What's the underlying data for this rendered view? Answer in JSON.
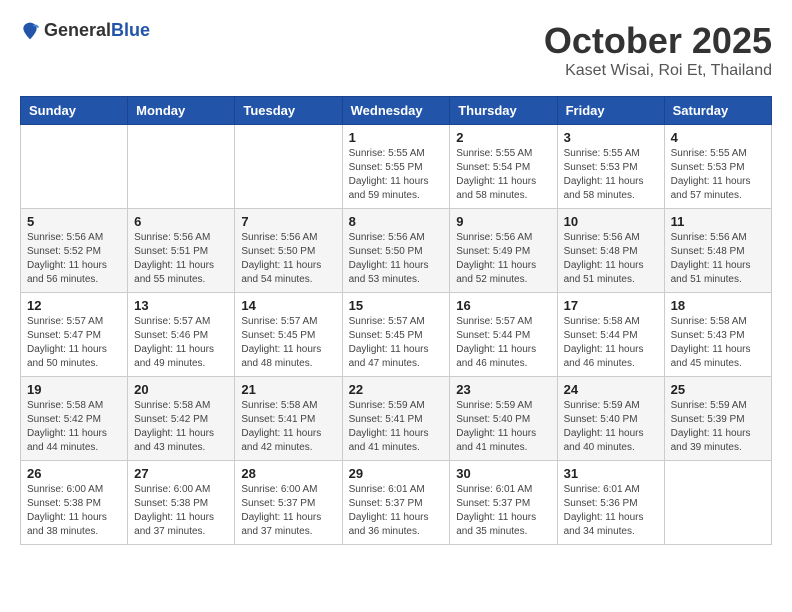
{
  "header": {
    "logo_general": "General",
    "logo_blue": "Blue",
    "month": "October 2025",
    "location": "Kaset Wisai, Roi Et, Thailand"
  },
  "days_of_week": [
    "Sunday",
    "Monday",
    "Tuesday",
    "Wednesday",
    "Thursday",
    "Friday",
    "Saturday"
  ],
  "weeks": [
    [
      {
        "day": "",
        "info": ""
      },
      {
        "day": "",
        "info": ""
      },
      {
        "day": "",
        "info": ""
      },
      {
        "day": "1",
        "info": "Sunrise: 5:55 AM\nSunset: 5:55 PM\nDaylight: 11 hours\nand 59 minutes."
      },
      {
        "day": "2",
        "info": "Sunrise: 5:55 AM\nSunset: 5:54 PM\nDaylight: 11 hours\nand 58 minutes."
      },
      {
        "day": "3",
        "info": "Sunrise: 5:55 AM\nSunset: 5:53 PM\nDaylight: 11 hours\nand 58 minutes."
      },
      {
        "day": "4",
        "info": "Sunrise: 5:55 AM\nSunset: 5:53 PM\nDaylight: 11 hours\nand 57 minutes."
      }
    ],
    [
      {
        "day": "5",
        "info": "Sunrise: 5:56 AM\nSunset: 5:52 PM\nDaylight: 11 hours\nand 56 minutes."
      },
      {
        "day": "6",
        "info": "Sunrise: 5:56 AM\nSunset: 5:51 PM\nDaylight: 11 hours\nand 55 minutes."
      },
      {
        "day": "7",
        "info": "Sunrise: 5:56 AM\nSunset: 5:50 PM\nDaylight: 11 hours\nand 54 minutes."
      },
      {
        "day": "8",
        "info": "Sunrise: 5:56 AM\nSunset: 5:50 PM\nDaylight: 11 hours\nand 53 minutes."
      },
      {
        "day": "9",
        "info": "Sunrise: 5:56 AM\nSunset: 5:49 PM\nDaylight: 11 hours\nand 52 minutes."
      },
      {
        "day": "10",
        "info": "Sunrise: 5:56 AM\nSunset: 5:48 PM\nDaylight: 11 hours\nand 51 minutes."
      },
      {
        "day": "11",
        "info": "Sunrise: 5:56 AM\nSunset: 5:48 PM\nDaylight: 11 hours\nand 51 minutes."
      }
    ],
    [
      {
        "day": "12",
        "info": "Sunrise: 5:57 AM\nSunset: 5:47 PM\nDaylight: 11 hours\nand 50 minutes."
      },
      {
        "day": "13",
        "info": "Sunrise: 5:57 AM\nSunset: 5:46 PM\nDaylight: 11 hours\nand 49 minutes."
      },
      {
        "day": "14",
        "info": "Sunrise: 5:57 AM\nSunset: 5:45 PM\nDaylight: 11 hours\nand 48 minutes."
      },
      {
        "day": "15",
        "info": "Sunrise: 5:57 AM\nSunset: 5:45 PM\nDaylight: 11 hours\nand 47 minutes."
      },
      {
        "day": "16",
        "info": "Sunrise: 5:57 AM\nSunset: 5:44 PM\nDaylight: 11 hours\nand 46 minutes."
      },
      {
        "day": "17",
        "info": "Sunrise: 5:58 AM\nSunset: 5:44 PM\nDaylight: 11 hours\nand 46 minutes."
      },
      {
        "day": "18",
        "info": "Sunrise: 5:58 AM\nSunset: 5:43 PM\nDaylight: 11 hours\nand 45 minutes."
      }
    ],
    [
      {
        "day": "19",
        "info": "Sunrise: 5:58 AM\nSunset: 5:42 PM\nDaylight: 11 hours\nand 44 minutes."
      },
      {
        "day": "20",
        "info": "Sunrise: 5:58 AM\nSunset: 5:42 PM\nDaylight: 11 hours\nand 43 minutes."
      },
      {
        "day": "21",
        "info": "Sunrise: 5:58 AM\nSunset: 5:41 PM\nDaylight: 11 hours\nand 42 minutes."
      },
      {
        "day": "22",
        "info": "Sunrise: 5:59 AM\nSunset: 5:41 PM\nDaylight: 11 hours\nand 41 minutes."
      },
      {
        "day": "23",
        "info": "Sunrise: 5:59 AM\nSunset: 5:40 PM\nDaylight: 11 hours\nand 41 minutes."
      },
      {
        "day": "24",
        "info": "Sunrise: 5:59 AM\nSunset: 5:40 PM\nDaylight: 11 hours\nand 40 minutes."
      },
      {
        "day": "25",
        "info": "Sunrise: 5:59 AM\nSunset: 5:39 PM\nDaylight: 11 hours\nand 39 minutes."
      }
    ],
    [
      {
        "day": "26",
        "info": "Sunrise: 6:00 AM\nSunset: 5:38 PM\nDaylight: 11 hours\nand 38 minutes."
      },
      {
        "day": "27",
        "info": "Sunrise: 6:00 AM\nSunset: 5:38 PM\nDaylight: 11 hours\nand 37 minutes."
      },
      {
        "day": "28",
        "info": "Sunrise: 6:00 AM\nSunset: 5:37 PM\nDaylight: 11 hours\nand 37 minutes."
      },
      {
        "day": "29",
        "info": "Sunrise: 6:01 AM\nSunset: 5:37 PM\nDaylight: 11 hours\nand 36 minutes."
      },
      {
        "day": "30",
        "info": "Sunrise: 6:01 AM\nSunset: 5:37 PM\nDaylight: 11 hours\nand 35 minutes."
      },
      {
        "day": "31",
        "info": "Sunrise: 6:01 AM\nSunset: 5:36 PM\nDaylight: 11 hours\nand 34 minutes."
      },
      {
        "day": "",
        "info": ""
      }
    ]
  ]
}
